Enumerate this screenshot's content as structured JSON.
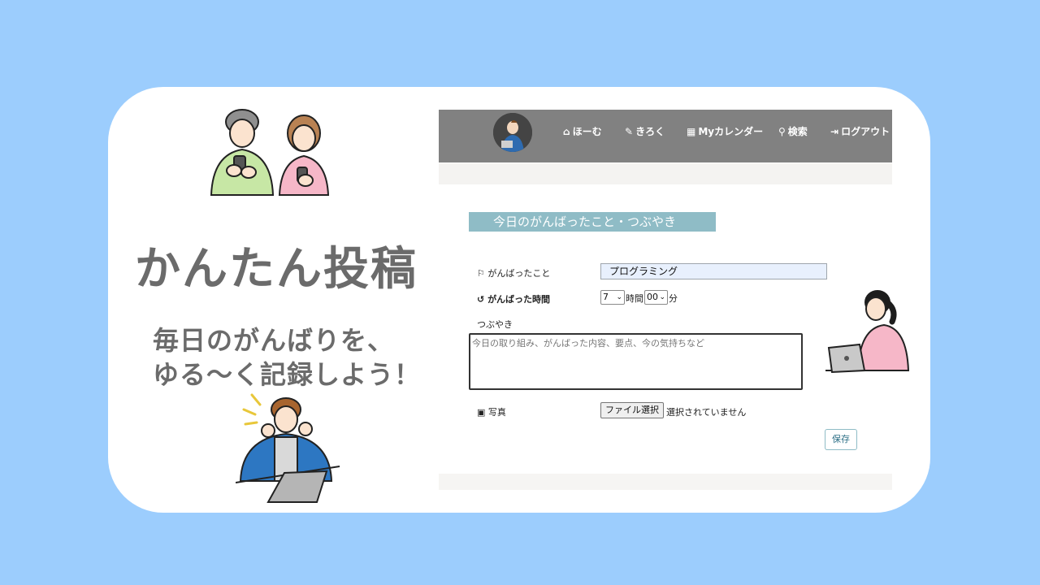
{
  "promo": {
    "headline": "かんたん投稿",
    "subline1": "毎日のがんばりを、",
    "subline2": "ゆる～く記録しよう！"
  },
  "nav": {
    "items": [
      {
        "icon": "home-icon",
        "label": "ほーむ"
      },
      {
        "icon": "edit-icon",
        "label": "きろく"
      },
      {
        "icon": "calendar-icon",
        "label": "Myカレンダー"
      },
      {
        "icon": "search-icon",
        "label": "検索"
      },
      {
        "icon": "logout-icon",
        "label": "ログアウト"
      }
    ]
  },
  "form": {
    "title": "今日のがんばったこと・つぶやき",
    "effort_label": "がんばったこと",
    "effort_value": "プログラミング",
    "time_label": "がんばった時間",
    "hours_value": "7",
    "hours_unit": "時間",
    "minutes_value": "00",
    "minutes_unit": "分",
    "tweet_label": "つぶやき",
    "tweet_placeholder": "今日の取り組み、がんばった内容、要点、今の気持ちなど",
    "photo_label": "写真",
    "file_button": "ファイル選択",
    "file_status": "選択されていません",
    "save_button": "保存"
  },
  "colors": {
    "background": "#9ccdfd",
    "navbar": "#818181",
    "section_title": "#8fbcc6",
    "headline_text": "#6b6b6b"
  }
}
